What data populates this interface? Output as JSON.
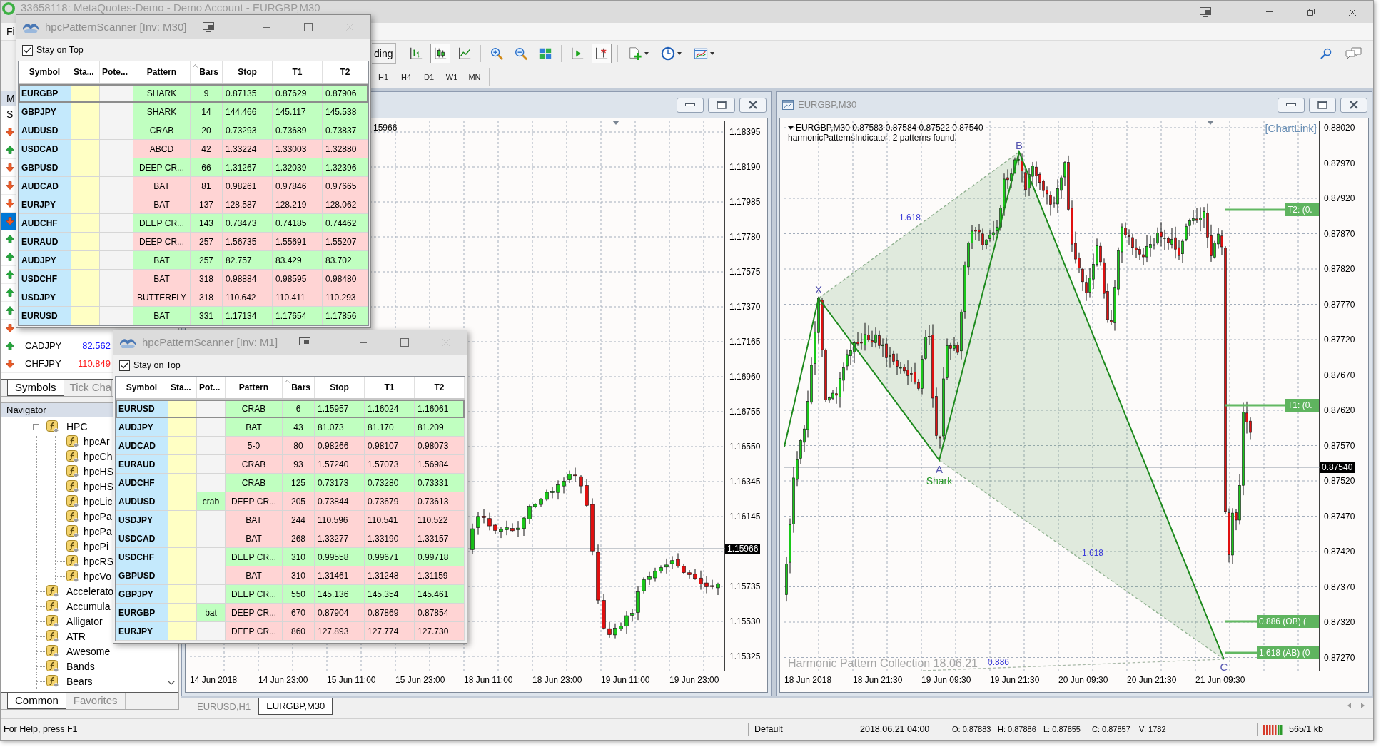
{
  "main_window": {
    "title": "33658118: MetaQuotes-Demo - Demo Account - EURGBP,M30",
    "menu": [
      "Fi"
    ]
  },
  "toolbar": {
    "autotrading": "ding",
    "buttons": [
      {
        "kind": "bar-chart",
        "pressed": false
      },
      {
        "kind": "candlesticks",
        "pressed": true
      },
      {
        "kind": "line-chart",
        "pressed": false
      },
      {
        "kind": "separator"
      },
      {
        "kind": "zoom-in",
        "pressed": false
      },
      {
        "kind": "zoom-out",
        "pressed": false
      },
      {
        "kind": "tile-windows",
        "pressed": false
      },
      {
        "kind": "separator"
      },
      {
        "kind": "auto-scroll",
        "pressed": false
      },
      {
        "kind": "chart-shift",
        "pressed": true
      },
      {
        "kind": "separator"
      },
      {
        "kind": "indicators",
        "pressed": false
      },
      {
        "kind": "periods",
        "pressed": false
      },
      {
        "kind": "templates",
        "pressed": false
      }
    ],
    "timeframes": [
      "H1",
      "H4",
      "D1",
      "W1",
      "MN"
    ]
  },
  "market_watch": {
    "title": "M",
    "column": "S",
    "rows": [
      {
        "rising": false,
        "selected": false
      },
      {
        "rising": true,
        "selected": false
      },
      {
        "rising": false,
        "selected": false
      },
      {
        "rising": false,
        "selected": false
      },
      {
        "rising": false,
        "selected": false
      },
      {
        "rising": false,
        "selected": true
      },
      {
        "rising": true,
        "selected": false
      },
      {
        "rising": true,
        "selected": false
      },
      {
        "rising": true,
        "selected": false
      },
      {
        "rising": true,
        "selected": false
      },
      {
        "rising": true,
        "selected": false
      },
      {
        "rising": false,
        "selected": false
      },
      {
        "symbol": "CADJPY",
        "bid": "82.562",
        "rising": true,
        "selected": false
      },
      {
        "symbol": "CHFJPY",
        "bid": "110.849",
        "rising": false,
        "selected": false
      }
    ],
    "tabs": [
      {
        "label": "Symbols",
        "selected": true
      },
      {
        "label": "Tick Cha",
        "selected": false
      }
    ]
  },
  "navigator": {
    "title": "Navigator",
    "tree": [
      {
        "label": "HPC",
        "expanded": true,
        "children": [
          {
            "label": "hpcAr"
          },
          {
            "label": "hpcCh"
          },
          {
            "label": "hpcHS"
          },
          {
            "label": "hpcHS"
          },
          {
            "label": "hpcLic"
          },
          {
            "label": "hpcPa"
          },
          {
            "label": "hpcPa"
          },
          {
            "label": "hpcPi"
          },
          {
            "label": "hpcRS"
          },
          {
            "label": "hpcVo"
          }
        ]
      },
      {
        "label": "Accelerato"
      },
      {
        "label": "Accumula"
      },
      {
        "label": "Alligator"
      },
      {
        "label": "ATR"
      },
      {
        "label": "Awesome"
      },
      {
        "label": "Bands"
      },
      {
        "label": "Bears"
      }
    ],
    "tabs": [
      {
        "label": "Common",
        "selected": true
      },
      {
        "label": "Favorites",
        "selected": false
      }
    ]
  },
  "charts": [
    {
      "header": "15966",
      "price_ticks": [
        "1.18395",
        "1.18190",
        "1.17985",
        "1.17780",
        "1.17575",
        "1.17370",
        "1.17165",
        "1.16960",
        "1.16755",
        "1.16550",
        "1.16345",
        "1.16145",
        "1.15735",
        "1.15530",
        "1.15325"
      ],
      "current_price": "1.15966",
      "time_labels": [
        "14 Jun 2018",
        "14 Jun 23:00",
        "15 Jun 11:00",
        "15 Jun 23:00",
        "18 Jun 11:00",
        "18 Jun 23:00",
        "19 Jun 11:00",
        "19 Jun 23:00"
      ]
    },
    {
      "title": "EURGBP,M30",
      "header": "EURGBP,M30 0.87583 0.87584 0.87522 0.87540",
      "note": "harmonicPatternsIndicator: 2 patterns found.",
      "link": "[ChartLink]",
      "price_ticks": [
        "0.88020",
        "0.87970",
        "0.87920",
        "0.87870",
        "0.87820",
        "0.87770",
        "0.87720",
        "0.87670",
        "0.87620",
        "0.87570",
        "0.87520",
        "0.87470",
        "0.87420",
        "0.87370",
        "0.87320",
        "0.87270"
      ],
      "current_price": "0.87540",
      "time_labels": [
        "18 Jun 2018",
        "18 Jun 21:30",
        "19 Jun 09:30",
        "19 Jun 21:30",
        "20 Jun 09:30",
        "20 Jun 21:30",
        "21 Jun 09:30"
      ],
      "pattern": {
        "name": "Shark",
        "points": [
          "X",
          "A",
          "B",
          "C"
        ],
        "ratios": [
          "1.618",
          "1.618",
          "0.886"
        ],
        "levels": [
          "T2: (0.",
          "T1: (0.",
          "0.886 (OB) (",
          "1.618 (AB) (0"
        ],
        "caption": "Harmonic Pattern Collection 18.06.21"
      }
    }
  ],
  "chart_tabs": [
    {
      "label": "EURUSD,H1",
      "selected": false
    },
    {
      "label": "EURGBP,M30",
      "selected": true
    }
  ],
  "status_bar": {
    "help": "For Help, press F1",
    "profile": "Default",
    "datetime": "2018.06.21 04:00",
    "ohlcv": [
      "O: 0.87883",
      "H: 0.87886",
      "L: 0.87855",
      "C: 0.87857",
      "V: 1782"
    ],
    "traffic": "565/1 kb"
  },
  "scanners": [
    {
      "title": "hpcPatternScanner [Inv: M30]",
      "stay_on_top": {
        "label": "Stay on Top",
        "checked": true
      },
      "columns": [
        {
          "label": "Symbol",
          "sorted": false
        },
        {
          "label": "Sta...",
          "sorted": false
        },
        {
          "label": "Pote...",
          "sorted": false
        },
        {
          "label": "Pattern",
          "sorted": false
        },
        {
          "label": "Bars",
          "sorted": true
        },
        {
          "label": "Stop",
          "sorted": false
        },
        {
          "label": "T1",
          "sorted": false
        },
        {
          "label": "T2",
          "sorted": false
        }
      ],
      "rows": [
        {
          "symbol": "EURGBP",
          "pattern": "SHARK",
          "bars": "9",
          "stop": "0.87135",
          "t1": "0.87629",
          "t2": "0.87906",
          "bullish": true,
          "selected": true
        },
        {
          "symbol": "GBPJPY",
          "pattern": "SHARK",
          "bars": "14",
          "stop": "144.466",
          "t1": "145.117",
          "t2": "145.538",
          "bullish": true,
          "selected": false
        },
        {
          "symbol": "AUDUSD",
          "pattern": "CRAB",
          "bars": "20",
          "stop": "0.73293",
          "t1": "0.73689",
          "t2": "0.73837",
          "bullish": true,
          "selected": false
        },
        {
          "symbol": "USDCAD",
          "pattern": "ABCD",
          "bars": "42",
          "stop": "1.33224",
          "t1": "1.33003",
          "t2": "1.32880",
          "bullish": false,
          "selected": false
        },
        {
          "symbol": "GBPUSD",
          "pattern": "DEEP CR...",
          "bars": "66",
          "stop": "1.31267",
          "t1": "1.32039",
          "t2": "1.32396",
          "bullish": true,
          "selected": false
        },
        {
          "symbol": "AUDCAD",
          "pattern": "BAT",
          "bars": "81",
          "stop": "0.98261",
          "t1": "0.97846",
          "t2": "0.97665",
          "bullish": false,
          "selected": false
        },
        {
          "symbol": "EURJPY",
          "pattern": "BAT",
          "bars": "137",
          "stop": "128.587",
          "t1": "128.219",
          "t2": "128.062",
          "bullish": false,
          "selected": false
        },
        {
          "symbol": "AUDCHF",
          "pattern": "DEEP CR...",
          "bars": "143",
          "stop": "0.73473",
          "t1": "0.74185",
          "t2": "0.74462",
          "bullish": true,
          "selected": false
        },
        {
          "symbol": "EURAUD",
          "pattern": "DEEP CR...",
          "bars": "257",
          "stop": "1.56735",
          "t1": "1.55691",
          "t2": "1.55207",
          "bullish": false,
          "selected": false
        },
        {
          "symbol": "AUDJPY",
          "pattern": "BAT",
          "bars": "257",
          "stop": "82.757",
          "t1": "83.429",
          "t2": "83.702",
          "bullish": true,
          "selected": false
        },
        {
          "symbol": "USDCHF",
          "pattern": "BAT",
          "bars": "318",
          "stop": "0.98884",
          "t1": "0.98595",
          "t2": "0.98480",
          "bullish": false,
          "selected": false
        },
        {
          "symbol": "USDJPY",
          "pattern": "BUTTERFLY",
          "bars": "318",
          "stop": "110.642",
          "t1": "110.411",
          "t2": "110.293",
          "bullish": false,
          "selected": false
        },
        {
          "symbol": "EURUSD",
          "pattern": "BAT",
          "bars": "331",
          "stop": "1.17134",
          "t1": "1.17654",
          "t2": "1.17856",
          "bullish": true,
          "selected": false
        }
      ]
    },
    {
      "title": "hpcPatternScanner [Inv: M1]",
      "stay_on_top": {
        "label": "Stay on Top",
        "checked": true
      },
      "columns": [
        {
          "label": "Symbol",
          "sorted": false
        },
        {
          "label": "Sta...",
          "sorted": false
        },
        {
          "label": "Pot...",
          "sorted": false
        },
        {
          "label": "Pattern",
          "sorted": false
        },
        {
          "label": "Bars",
          "sorted": true
        },
        {
          "label": "Stop",
          "sorted": false
        },
        {
          "label": "T1",
          "sorted": false
        },
        {
          "label": "T2",
          "sorted": false
        }
      ],
      "rows": [
        {
          "symbol": "EURUSD",
          "pattern": "CRAB",
          "bars": "6",
          "stop": "1.15957",
          "t1": "1.16024",
          "t2": "1.16061",
          "bullish": true,
          "selected": true
        },
        {
          "symbol": "AUDJPY",
          "pattern": "BAT",
          "bars": "43",
          "stop": "81.073",
          "t1": "81.170",
          "t2": "81.209",
          "bullish": true,
          "selected": false
        },
        {
          "symbol": "AUDCAD",
          "pattern": "5-0",
          "bars": "80",
          "stop": "0.98266",
          "t1": "0.98107",
          "t2": "0.98073",
          "bullish": false,
          "selected": false
        },
        {
          "symbol": "EURAUD",
          "pattern": "CRAB",
          "bars": "93",
          "stop": "1.57240",
          "t1": "1.57073",
          "t2": "1.56984",
          "bullish": false,
          "selected": false
        },
        {
          "symbol": "AUDCHF",
          "pattern": "CRAB",
          "bars": "125",
          "stop": "0.73173",
          "t1": "0.73280",
          "t2": "0.73331",
          "bullish": true,
          "selected": false
        },
        {
          "symbol": "AUDUSD",
          "potential": "crab",
          "pattern": "DEEP CR...",
          "bars": "205",
          "stop": "0.73844",
          "t1": "0.73679",
          "t2": "0.73613",
          "bullish": false,
          "selected": false
        },
        {
          "symbol": "USDJPY",
          "pattern": "BAT",
          "bars": "244",
          "stop": "110.596",
          "t1": "110.541",
          "t2": "110.522",
          "bullish": false,
          "selected": false
        },
        {
          "symbol": "USDCAD",
          "pattern": "BAT",
          "bars": "268",
          "stop": "1.33277",
          "t1": "1.33190",
          "t2": "1.33157",
          "bullish": false,
          "selected": false
        },
        {
          "symbol": "USDCHF",
          "pattern": "DEEP CR...",
          "bars": "310",
          "stop": "0.99558",
          "t1": "0.99671",
          "t2": "0.99718",
          "bullish": true,
          "selected": false
        },
        {
          "symbol": "GBPUSD",
          "pattern": "BAT",
          "bars": "310",
          "stop": "1.31461",
          "t1": "1.31248",
          "t2": "1.31159",
          "bullish": false,
          "selected": false
        },
        {
          "symbol": "GBPJPY",
          "pattern": "DEEP CR...",
          "bars": "550",
          "stop": "145.136",
          "t1": "145.354",
          "t2": "145.461",
          "bullish": true,
          "selected": false
        },
        {
          "symbol": "EURGBP",
          "potential": "bat",
          "pattern": "DEEP CR...",
          "bars": "670",
          "stop": "0.87904",
          "t1": "0.87869",
          "t2": "0.87854",
          "bullish": false,
          "selected": false
        },
        {
          "symbol": "EURJPY",
          "pattern": "DEEP CR...",
          "bars": "860",
          "stop": "127.893",
          "t1": "127.774",
          "t2": "127.730",
          "bullish": false,
          "selected": false
        }
      ]
    }
  ]
}
